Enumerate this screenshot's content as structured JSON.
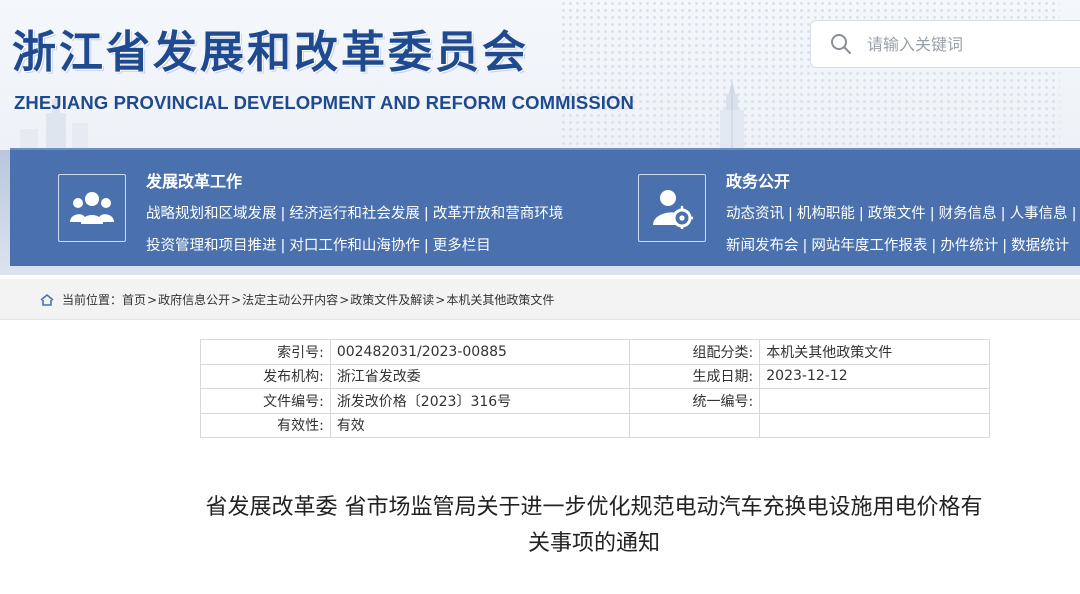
{
  "header": {
    "title": "浙江省发展和改革委员会",
    "subtitle": "ZHEJIANG PROVINCIAL DEVELOPMENT AND REFORM COMMISSION",
    "search": {
      "placeholder": "请输入关键词",
      "icon": "search-icon"
    }
  },
  "nav": {
    "left": {
      "icon": "people-icon",
      "heading": "发展改革工作",
      "line1": [
        "战略规划和区域发展",
        "经济运行和社会发展",
        "改革开放和营商环境"
      ],
      "line2": [
        "投资管理和项目推进",
        "对口工作和山海协作",
        "更多栏目"
      ]
    },
    "right": {
      "icon": "user-settings-icon",
      "heading": "政务公开",
      "line1": [
        "动态资讯",
        "机构职能",
        "政策文件",
        "财务信息",
        "人事信息"
      ],
      "line2": [
        "新闻发布会",
        "网站年度工作报表",
        "办件统计",
        "数据统计"
      ]
    },
    "separator": "|"
  },
  "breadcrumb": {
    "label": "当前位置：",
    "items": [
      "首页",
      "政府信息公开",
      "法定主动公开内容",
      "政策文件及解读",
      "本机关其他政策文件"
    ],
    "separator": ">"
  },
  "meta": {
    "rows": [
      {
        "k1": "索引号:",
        "v1": "002482031/2023-00885",
        "k2": "组配分类:",
        "v2": "本机关其他政策文件"
      },
      {
        "k1": "发布机构:",
        "v1": "浙江省发改委",
        "k2": "生成日期:",
        "v2": "2023-12-12"
      },
      {
        "k1": "文件编号:",
        "v1": "浙发改价格〔2023〕316号",
        "k2": "统一编号:",
        "v2": ""
      },
      {
        "k1": "有效性:",
        "v1": "有效",
        "k2": "",
        "v2": ""
      }
    ]
  },
  "document": {
    "title_line1": "省发展改革委 省市场监管局关于进一步优化规范电动汽车充换电设施用电价格有",
    "title_line2": "关事项的通知"
  },
  "colors": {
    "brand_blue": "#1f4a8f",
    "nav_blue": "#4a71ad"
  }
}
